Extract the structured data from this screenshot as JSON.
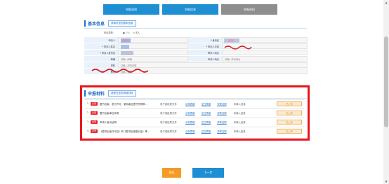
{
  "tabs": [
    {
      "label": "申报须知"
    },
    {
      "label": "申报信息"
    },
    {
      "label": "申报材料"
    }
  ],
  "basic_info": {
    "title": "基本信息",
    "hint": "请填写您的基本信息",
    "applicant_type_label": "申请类型:",
    "applicant_type_options": [
      "个人",
      "法人"
    ],
    "fields": {
      "applicant": "申请人",
      "id_number": "* 身份证",
      "applicant_name": "* 申请人姓名",
      "applicant_phone": "* 申请人手机",
      "applicant_id": "* 申请人身份证",
      "contact_address": "联系人地址",
      "postcode": "邮编",
      "applicant_address": "申请人地址",
      "material": "材料",
      "remark": "备注"
    },
    "placeholders": {
      "postcode": "请输入邮编",
      "applicant_address": "请输入申请地址",
      "material": "请输入材料说明",
      "remark": "请输入备注"
    }
  },
  "materials": {
    "title": "申报材料",
    "hint": "请提交您的申报材料",
    "rows": [
      {
        "num": "1",
        "tag": "必须",
        "name": "图书出版、发行许可、使用者应遵守的规章...",
        "type": "电子或纸质文件",
        "sample": "示例表格",
        "blank": "空白表格",
        "explain": "关联证照",
        "status": "未填入信息",
        "action": "已上传"
      },
      {
        "num": "2",
        "tag": "必须",
        "name": "图书出版单位申请",
        "type": "电子或纸质文件",
        "sample": "示例表格",
        "blank": "空白表格",
        "explain": "关联证照",
        "status": "未填入信息",
        "action": "已上传"
      },
      {
        "num": "3",
        "tag": "必须",
        "name": "申请人身份证明",
        "type": "电子或纸质文件",
        "sample": "示例表格",
        "blank": "空白表格",
        "explain": "关联证照",
        "status": "未填入信息",
        "action": "已上传"
      },
      {
        "num": "4",
        "tag": "必须",
        "name": "《图书出版许可证》和《图书出版登记证》等...",
        "type": "电子或纸质文件",
        "sample": "示例表格",
        "blank": "空白表格",
        "explain": "关联证照",
        "status": "未填入信息",
        "action": "已上传"
      }
    ]
  },
  "buttons": {
    "save": "保存",
    "next": "下一步"
  },
  "colors": {
    "primary": "#1e8fd3",
    "highlight_border": "#e8151b",
    "save": "#f59a23"
  }
}
